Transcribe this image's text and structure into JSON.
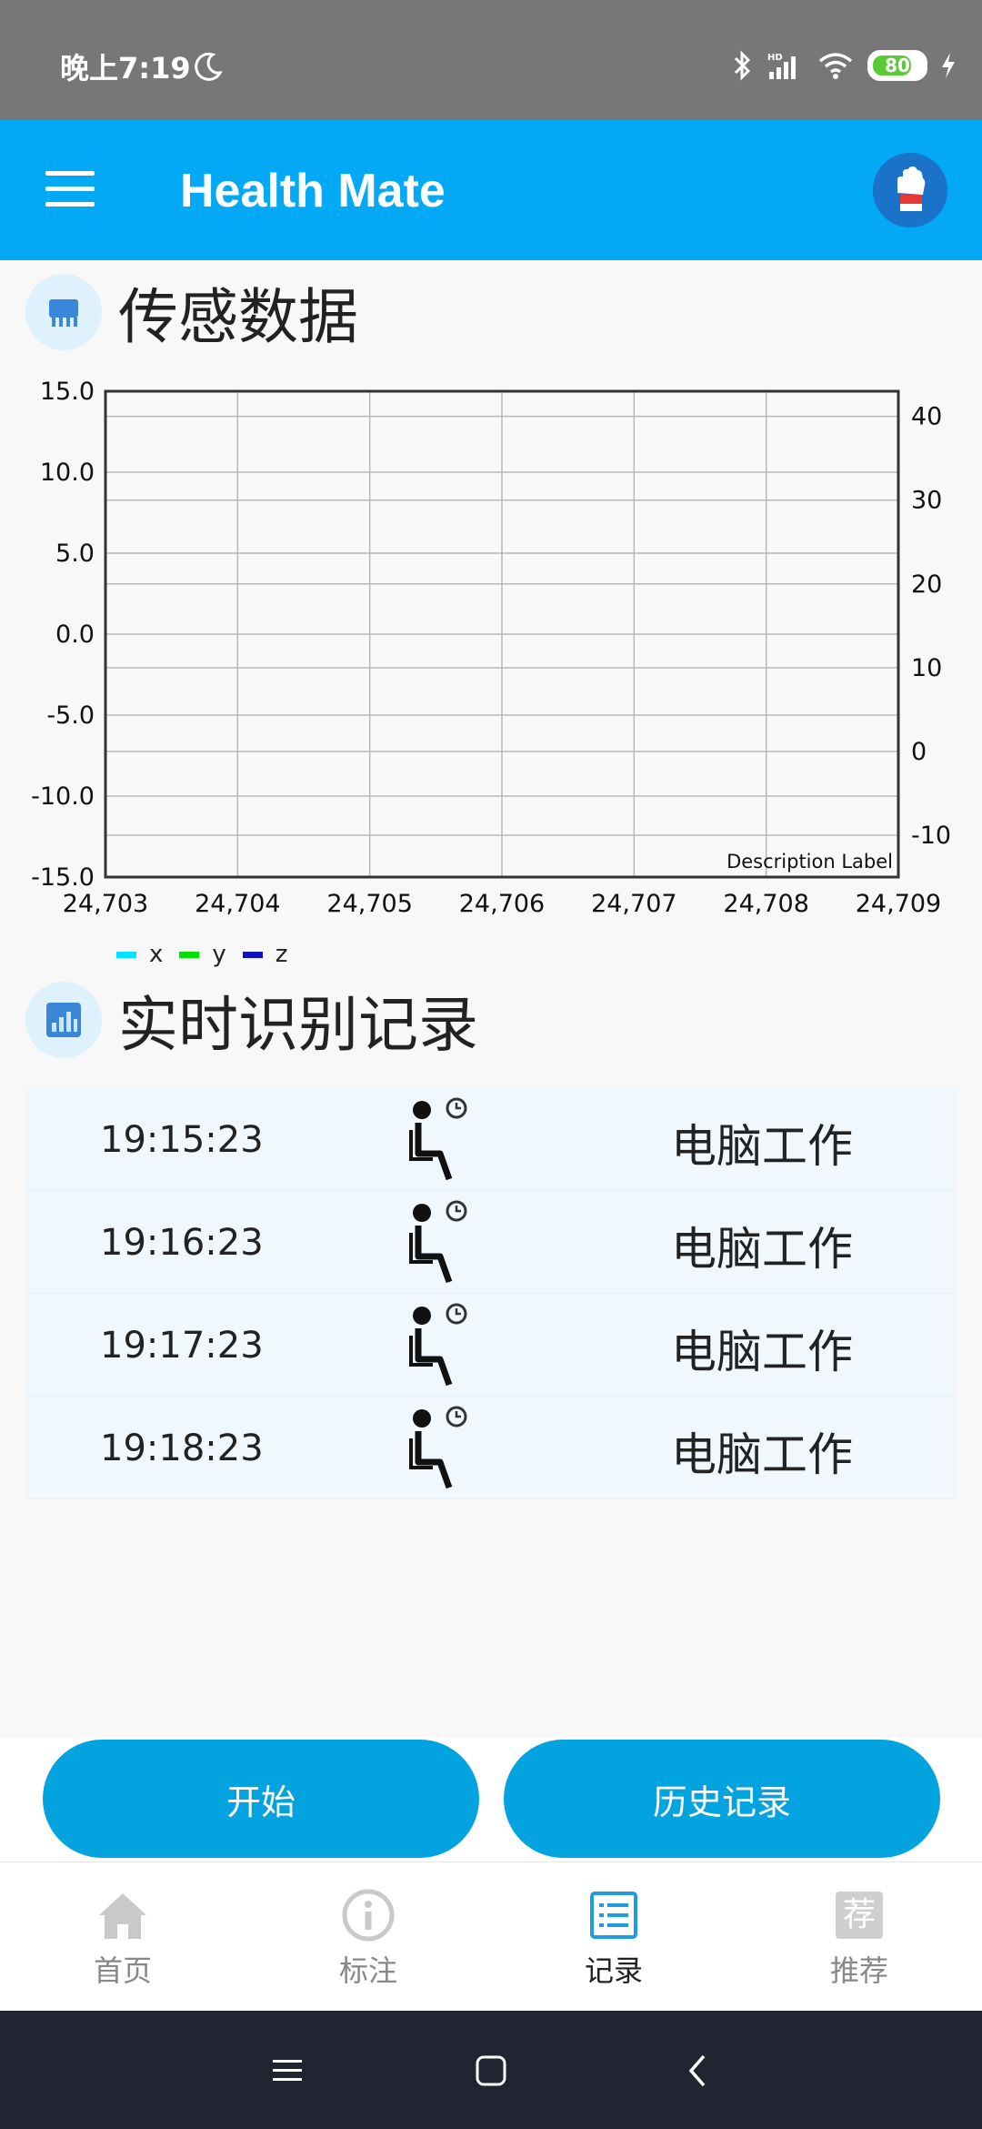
{
  "status_bar": {
    "time": "晚上7:19",
    "battery": 80,
    "battery_text": "80"
  },
  "app_bar": {
    "title": "Health Mate"
  },
  "sensor_section": {
    "title": "传感数据"
  },
  "chart_data": {
    "type": "line",
    "title": "",
    "x_ticks": [
      "24,703",
      "24,704",
      "24,705",
      "24,706",
      "24,707",
      "24,708",
      "24,709"
    ],
    "x_range": [
      24703,
      24709
    ],
    "y_left_ticks": [
      "15.0",
      "10.0",
      "5.0",
      "0.0",
      "-5.0",
      "-10.0",
      "-15.0"
    ],
    "y_left_range": [
      -15,
      15
    ],
    "y_right_ticks": [
      "40",
      "30",
      "20",
      "10",
      "0",
      "-10"
    ],
    "y_right_range": [
      -15,
      43
    ],
    "description": "Description Label",
    "grid": true,
    "legend_position": "bottom-left",
    "series": [
      {
        "name": "x",
        "color": "#00e5ff",
        "values": []
      },
      {
        "name": "y",
        "color": "#00e000",
        "values": []
      },
      {
        "name": "z",
        "color": "#1010c0",
        "values": []
      }
    ]
  },
  "records_section": {
    "title": "实时识别记录",
    "rows": [
      {
        "time": "19:15:23",
        "icon": "sitting-person-clock-icon",
        "activity": "电脑工作"
      },
      {
        "time": "19:16:23",
        "icon": "sitting-person-clock-icon",
        "activity": "电脑工作"
      },
      {
        "time": "19:17:23",
        "icon": "sitting-person-clock-icon",
        "activity": "电脑工作"
      },
      {
        "time": "19:18:23",
        "icon": "sitting-person-clock-icon",
        "activity": "电脑工作"
      }
    ]
  },
  "actions": {
    "start_label": "开始",
    "history_label": "历史记录"
  },
  "bottom_nav": {
    "items": [
      {
        "label": "首页",
        "icon": "home-icon",
        "active": false
      },
      {
        "label": "标注",
        "icon": "info-icon",
        "active": false
      },
      {
        "label": "记录",
        "icon": "list-icon",
        "active": true
      },
      {
        "label": "推荐",
        "icon": "recommend-icon",
        "active": false
      }
    ],
    "recommend_glyph": "荐"
  },
  "colors": {
    "primary": "#03a9f4",
    "button": "#03a3df",
    "row_bg": "#f1f8fd"
  }
}
